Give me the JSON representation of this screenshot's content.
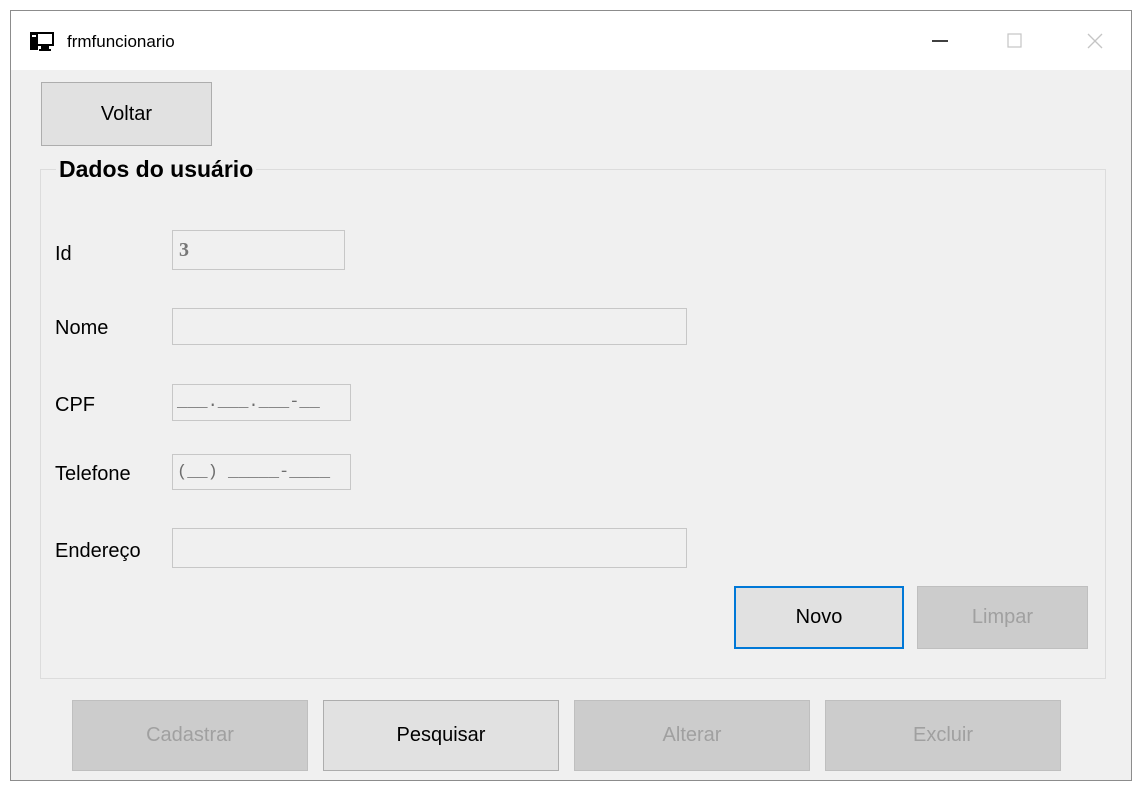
{
  "window": {
    "title": "frmfuncionario"
  },
  "toolbar": {
    "voltar_label": "Voltar"
  },
  "group": {
    "title": "Dados do usuário",
    "fields": {
      "id": {
        "label": "Id",
        "value": "3"
      },
      "nome": {
        "label": "Nome",
        "value": ""
      },
      "cpf": {
        "label": "CPF",
        "mask": "___.___.___-__"
      },
      "telefone": {
        "label": "Telefone",
        "mask": "(__) _____-____"
      },
      "endereco": {
        "label": "Endereço",
        "value": ""
      }
    },
    "novo_label": "Novo",
    "limpar_label": "Limpar"
  },
  "actions": {
    "cadastrar_label": "Cadastrar",
    "pesquisar_label": "Pesquisar",
    "alterar_label": "Alterar",
    "excluir_label": "Excluir"
  },
  "colors": {
    "window_bg": "#f0f0f0",
    "focus_border": "#0078d7",
    "disabled_text": "#a0a0a0"
  },
  "icons": [
    "app-icon",
    "minimize-icon",
    "maximize-icon",
    "close-icon"
  ]
}
